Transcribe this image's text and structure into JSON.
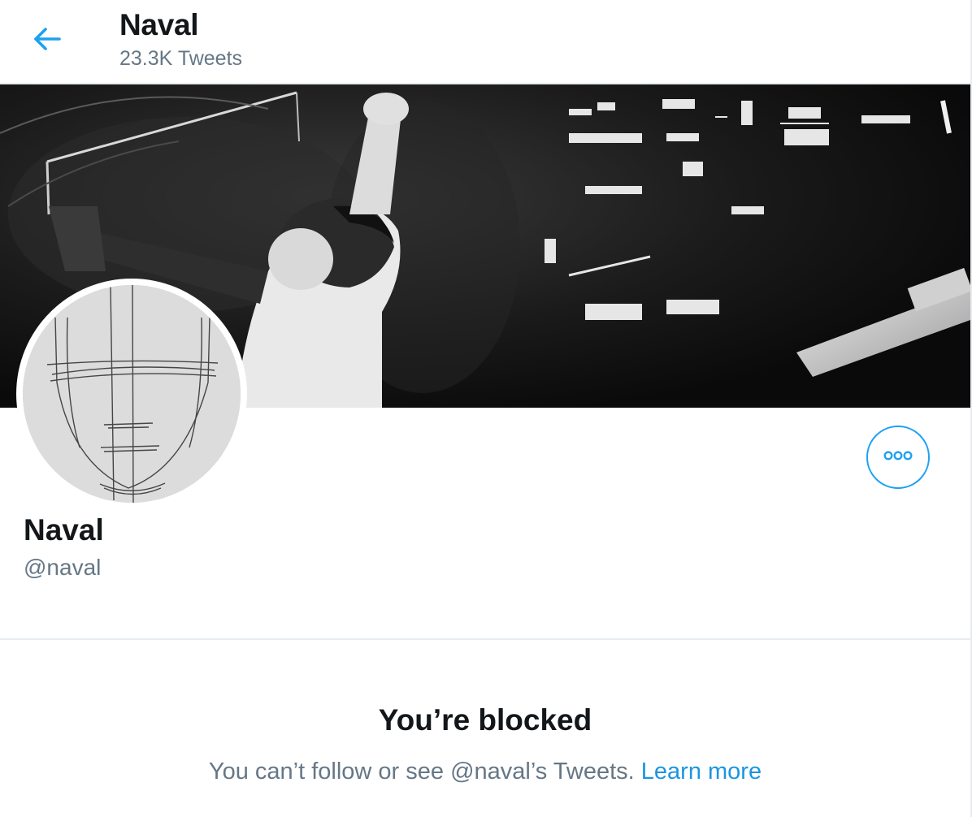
{
  "header": {
    "back_icon": "arrow-left-icon",
    "title": "Naval",
    "subtitle": "23.3K Tweets"
  },
  "banner": {
    "description_icon": "banner-photo-icon"
  },
  "profile": {
    "avatar_icon": "sketch-face-avatar-icon",
    "name": "Naval",
    "handle": "@naval",
    "more_icon": "more-options-icon"
  },
  "blocked": {
    "title": "You’re blocked",
    "message": "You can’t follow or see @naval’s Tweets.",
    "link_label": "Learn more"
  },
  "colors": {
    "accent": "#1da1f2",
    "link": "#1b95e0",
    "muted_text": "#657786",
    "primary_text": "#14171a",
    "divider": "#e6ecf0"
  }
}
